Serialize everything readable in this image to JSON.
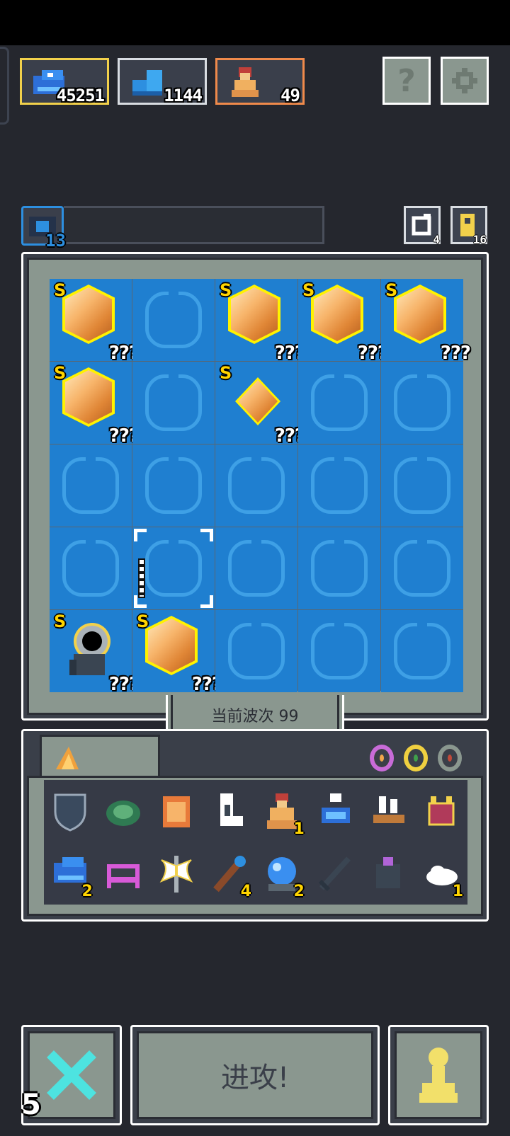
{
  "resources": [
    {
      "name": "blue-creature",
      "value": "45251",
      "border": "#f2d14b"
    },
    {
      "name": "blue-boots",
      "value": "1144",
      "border": "#d9dde2"
    },
    {
      "name": "hero-statue",
      "value": "49",
      "border": "#f08a4b"
    }
  ],
  "top_buttons": {
    "help_glyph": "?",
    "settings_icon": "gear-icon"
  },
  "level": {
    "value": "13"
  },
  "counters": {
    "refresh_count": "4",
    "key_count": "16"
  },
  "board": {
    "rows": 5,
    "cols": 5,
    "cells": [
      {
        "row": 0,
        "col": 0,
        "type": "gem",
        "rank": "S",
        "label": "???"
      },
      {
        "row": 0,
        "col": 2,
        "type": "gem",
        "rank": "S",
        "label": "???"
      },
      {
        "row": 0,
        "col": 3,
        "type": "gem",
        "rank": "S",
        "label": "???"
      },
      {
        "row": 0,
        "col": 4,
        "type": "gem",
        "rank": "S",
        "label": "???"
      },
      {
        "row": 1,
        "col": 0,
        "type": "gem",
        "rank": "S",
        "label": "???"
      },
      {
        "row": 1,
        "col": 2,
        "type": "gem-small",
        "rank": "S",
        "label": "???"
      },
      {
        "row": 3,
        "col": 1,
        "type": "selected",
        "rank": "",
        "label": ""
      },
      {
        "row": 4,
        "col": 0,
        "type": "cannon",
        "rank": "S",
        "label": "???"
      },
      {
        "row": 4,
        "col": 1,
        "type": "gem",
        "rank": "S",
        "label": "???"
      }
    ]
  },
  "wave": {
    "label": "当前波次 99"
  },
  "inventory": {
    "tab_icon": "orange-gem-shard-icon",
    "rings": [
      {
        "name": "orange-ring-icon",
        "color": "#c86bd8",
        "inner": "#f0a64b"
      },
      {
        "name": "green-ring-icon",
        "color": "#f0d040",
        "inner": "#3fa04b"
      },
      {
        "name": "red-ring-icon",
        "color": "#8a978f",
        "inner": "#c04a3a"
      }
    ],
    "items": [
      {
        "name": "shield-icon",
        "count": ""
      },
      {
        "name": "turtle-shell-icon",
        "count": ""
      },
      {
        "name": "armor-icon",
        "count": ""
      },
      {
        "name": "boot-icon",
        "count": ""
      },
      {
        "name": "hero-statue-icon",
        "count": "1"
      },
      {
        "name": "potion-icon",
        "count": ""
      },
      {
        "name": "ship-icon",
        "count": ""
      },
      {
        "name": "cat-icon",
        "count": ""
      },
      {
        "name": "blue-creature-icon",
        "count": "2"
      },
      {
        "name": "bed-icon",
        "count": ""
      },
      {
        "name": "battle-axe-icon",
        "count": ""
      },
      {
        "name": "staff-icon",
        "count": "4"
      },
      {
        "name": "crystal-ball-icon",
        "count": "2"
      },
      {
        "name": "sword-icon",
        "count": ""
      },
      {
        "name": "golem-icon",
        "count": ""
      },
      {
        "name": "cloud-icon",
        "count": "1"
      }
    ]
  },
  "bottom": {
    "attack_label": "进攻!",
    "skip_count": "5"
  }
}
